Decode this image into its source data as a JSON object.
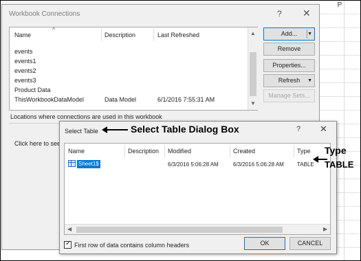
{
  "spreadsheet": {
    "column_header": "P"
  },
  "workbook_connections": {
    "title": "Workbook Connections",
    "help_label": "?",
    "close_label": "✕",
    "columns": [
      "Name",
      "Description",
      "Last Refreshed"
    ],
    "rows": [
      {
        "name": "events",
        "description": "",
        "last_refreshed": ""
      },
      {
        "name": "events1",
        "description": "",
        "last_refreshed": ""
      },
      {
        "name": "events2",
        "description": "",
        "last_refreshed": ""
      },
      {
        "name": "events3",
        "description": "",
        "last_refreshed": ""
      },
      {
        "name": "Product Data",
        "description": "",
        "last_refreshed": ""
      },
      {
        "name": "ThisWorkbookDataModel",
        "description": "Data Model",
        "last_refreshed": "6/1/2016 7:55:31 AM"
      }
    ],
    "buttons": {
      "add": "Add...",
      "remove": "Remove",
      "properties": "Properties...",
      "refresh": "Refresh",
      "manage_sets": "Manage Sets..."
    },
    "locations_label": "Locations where connections are used in this workbook",
    "locations_hint": "Click here to see"
  },
  "select_table": {
    "title": "Select Table",
    "help_label": "?",
    "close_label": "✕",
    "columns": [
      "Name",
      "Description",
      "Modified",
      "Created",
      "Type"
    ],
    "rows": [
      {
        "name": "Sheet1$",
        "description": "",
        "modified": "6/3/2016 5:06:28 AM",
        "created": "6/3/2016 5:06:28 AM",
        "type": "TABLE"
      }
    ],
    "checkbox_label": "First row of data contains column headers",
    "checkbox_checked": true,
    "ok_label": "OK",
    "cancel_label": "CANCEL"
  },
  "annotations": {
    "select_table": "Select Table Dialog Box",
    "type_line1": "Type",
    "type_line2": "TABLE"
  }
}
